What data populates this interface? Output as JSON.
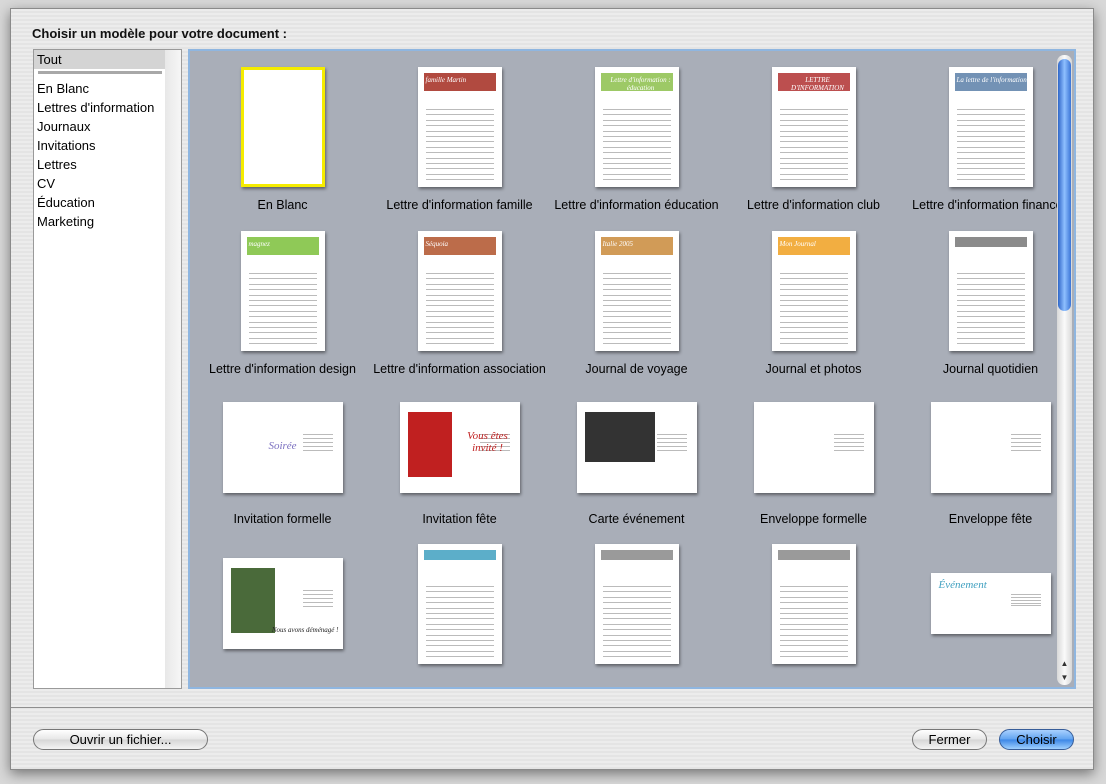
{
  "dialog": {
    "title": "Choisir un modèle pour votre document :"
  },
  "sidebar": {
    "selected": "Tout",
    "items": [
      "En Blanc",
      "Lettres d'information",
      "Journaux",
      "Invitations",
      "Lettres",
      "CV",
      "Éducation",
      "Marketing"
    ]
  },
  "templates": [
    {
      "label": "En Blanc",
      "orientation": "portrait",
      "selected": true,
      "accent": "#ffffff"
    },
    {
      "label": "Lettre d'information famille",
      "orientation": "portrait",
      "accent": "#a32a1e",
      "thumb_text": "famille Martin"
    },
    {
      "label": "Lettre d'information éducation",
      "orientation": "portrait",
      "accent": "#8cc04b",
      "thumb_text": "Lettre d'information : éducation"
    },
    {
      "label": "Lettre d'information club",
      "orientation": "portrait",
      "accent": "#b03030",
      "thumb_text": "LETTRE D'INFORMATION"
    },
    {
      "label": "Lettre d'information finances",
      "orientation": "portrait",
      "accent": "#5b7fa8",
      "thumb_text": "La lettre de l'information"
    },
    {
      "label": "Lettre d'information design",
      "orientation": "portrait",
      "accent": "#7bbf3a",
      "thumb_text": "magnez"
    },
    {
      "label": "Lettre d'information association",
      "orientation": "portrait",
      "accent": "#b0522a",
      "thumb_text": "Séquoia"
    },
    {
      "label": "Journal de voyage",
      "orientation": "portrait",
      "accent": "#c98a3a",
      "thumb_text": "Italie 2005"
    },
    {
      "label": "Journal et photos",
      "orientation": "portrait",
      "accent": "#f0a020",
      "thumb_text": "Mon Journal"
    },
    {
      "label": "Journal quotidien",
      "orientation": "portrait",
      "accent": "#777777"
    },
    {
      "label": "Invitation formelle",
      "orientation": "landscape",
      "accent": "#7a6fc0",
      "thumb_text": "Soirée"
    },
    {
      "label": "Invitation fête",
      "orientation": "landscape",
      "accent": "#c02020",
      "thumb_text": "Vous êtes invité !"
    },
    {
      "label": "Carte événement",
      "orientation": "landscape",
      "accent": "#333333"
    },
    {
      "label": "Enveloppe formelle",
      "orientation": "landscape",
      "accent": "#555555"
    },
    {
      "label": "Enveloppe fête",
      "orientation": "landscape",
      "accent": "#d04040"
    },
    {
      "label": "",
      "orientation": "landscape",
      "accent": "#4a6a3a",
      "thumb_text": "Nous avons déménagé !"
    },
    {
      "label": "",
      "orientation": "portrait",
      "accent": "#40a0c0"
    },
    {
      "label": "",
      "orientation": "portrait",
      "accent": "#888888"
    },
    {
      "label": "",
      "orientation": "portrait",
      "accent": "#888888"
    },
    {
      "label": "",
      "orientation": "landscape-short",
      "accent": "#40a0c0",
      "thumb_text": "Événement"
    }
  ],
  "buttons": {
    "open": "Ouvrir un fichier...",
    "close": "Fermer",
    "choose": "Choisir"
  },
  "colors": {
    "selection": "#f5ec00",
    "primary_button": "#3b86e6",
    "grid_bg": "#a9aeb8"
  }
}
